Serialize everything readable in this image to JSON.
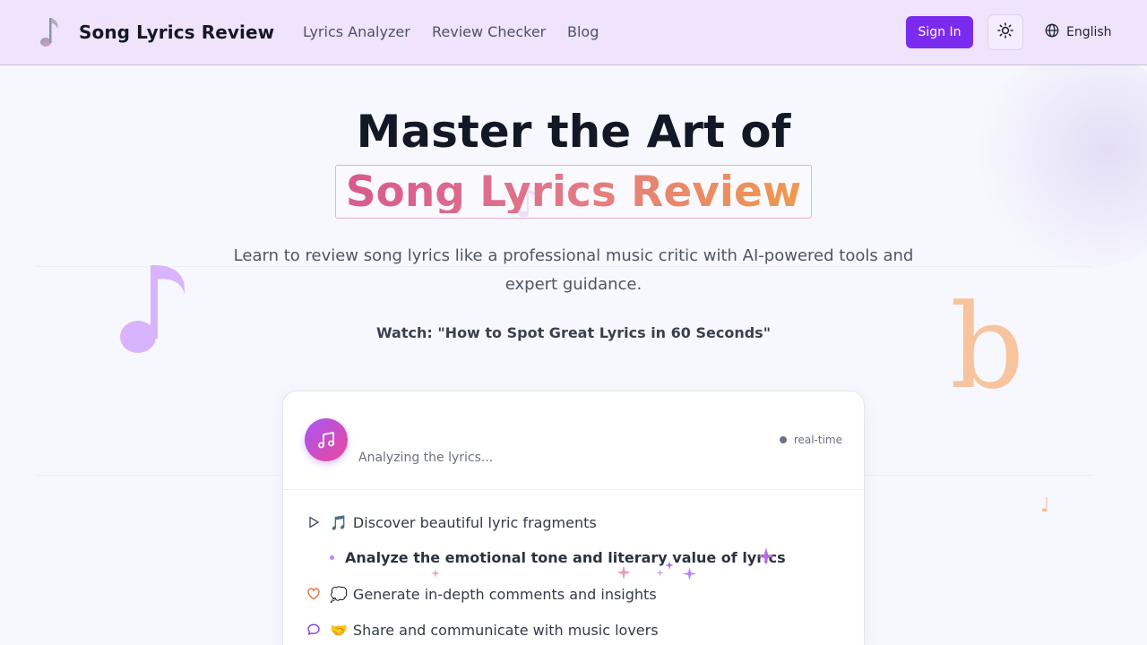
{
  "header": {
    "brand": "Song Lyrics Review",
    "logo_icon": "music-note-icon",
    "nav": [
      "Lyrics Analyzer",
      "Review Checker",
      "Blog"
    ],
    "signin_label": "Sign In",
    "theme_icon": "sun-icon",
    "language": "English",
    "language_icon": "globe-icon"
  },
  "hero": {
    "title": "Master the Art of",
    "highlight": "Song Lyrics Review",
    "subtitle": "Learn to review song lyrics like a professional music critic with AI-powered tools and expert guidance.",
    "watch": "Watch: \"How to Spot Great Lyrics in 60 Seconds\""
  },
  "card": {
    "avatar_icon": "music-note-icon",
    "status": "Analyzing the lyrics...",
    "realtime": "real-time",
    "items": [
      {
        "icon": "play-icon",
        "emoji": "🎵",
        "text": "Discover beautiful lyric fragments"
      },
      {
        "icon": "bullet",
        "emoji": "",
        "text": "Analyze the emotional tone and literary value of lyrics"
      },
      {
        "icon": "heart-icon",
        "emoji": "💭",
        "text": "Generate in-depth comments and insights"
      },
      {
        "icon": "chat-icon",
        "emoji": "🤝",
        "text": "Share and communicate with music lovers"
      }
    ]
  },
  "colors": {
    "header_bg": "#efe4fc",
    "accent": "#7b2bf0",
    "gradient_start": "#d8598f",
    "gradient_end": "#f0994e"
  },
  "decorations": {
    "note_glyph": "♪",
    "flat_glyph": "b",
    "small_note_glyph": "♩"
  }
}
